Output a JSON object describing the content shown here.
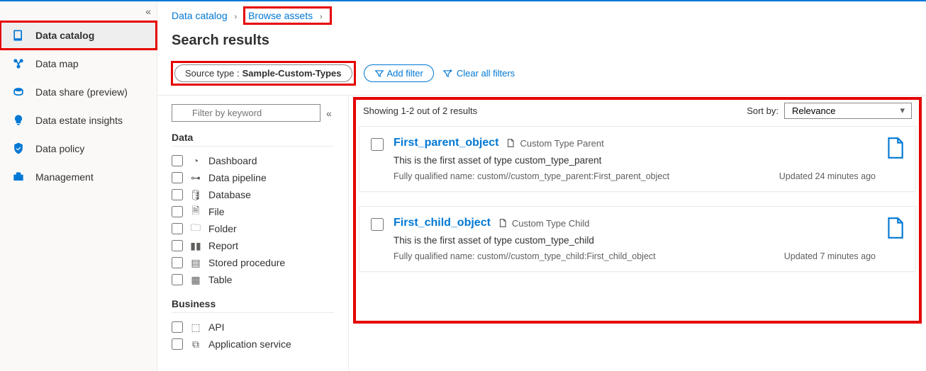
{
  "nav": {
    "items": [
      {
        "label": "Data catalog",
        "selected": true
      },
      {
        "label": "Data map"
      },
      {
        "label": "Data share (preview)"
      },
      {
        "label": "Data estate insights"
      },
      {
        "label": "Data policy"
      },
      {
        "label": "Management"
      }
    ]
  },
  "breadcrumb": {
    "root": "Data catalog",
    "current": "Browse assets"
  },
  "page": {
    "title": "Search results"
  },
  "filters": {
    "chip_label": "Source type :",
    "chip_value": "Sample-Custom-Types",
    "add_label": "Add filter",
    "clear_label": "Clear all filters"
  },
  "facet_panel": {
    "search_placeholder": "Filter by keyword",
    "groups": [
      {
        "title": "Data",
        "items": [
          "Dashboard",
          "Data pipeline",
          "Database",
          "File",
          "Folder",
          "Report",
          "Stored procedure",
          "Table"
        ]
      },
      {
        "title": "Business",
        "items": [
          "API",
          "Application service"
        ]
      }
    ]
  },
  "results": {
    "count_text": "Showing 1-2 out of 2 results",
    "sort_label": "Sort by:",
    "sort_value": "Relevance",
    "items": [
      {
        "title": "First_parent_object",
        "type": "Custom Type Parent",
        "description": "This is the first asset of type custom_type_parent",
        "fqn_label": "Fully qualified name:",
        "fqn": "custom//custom_type_parent:First_parent_object",
        "updated": "Updated 24 minutes ago"
      },
      {
        "title": "First_child_object",
        "type": "Custom Type Child",
        "description": "This is the first asset of type custom_type_child",
        "fqn_label": "Fully qualified name:",
        "fqn": "custom//custom_type_child:First_child_object",
        "updated": "Updated 7 minutes ago"
      }
    ]
  }
}
